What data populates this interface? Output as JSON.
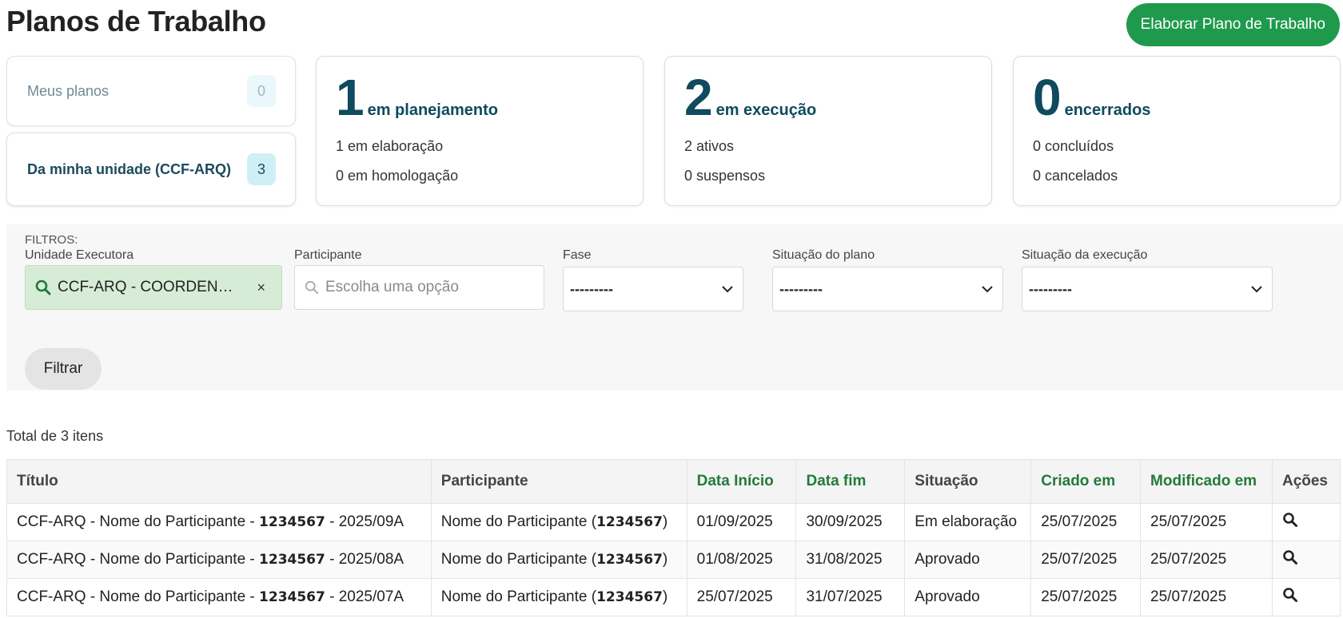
{
  "header": {
    "title": "Planos de Trabalho",
    "create_button": "Elaborar Plano de Trabalho"
  },
  "scopes": {
    "mine": {
      "label": "Meus planos",
      "count": "0"
    },
    "unit": {
      "label": "Da minha unidade (CCF-ARQ)",
      "count": "3"
    }
  },
  "stats": [
    {
      "number": "1",
      "label": "em planejamento",
      "line1": "1 em elaboração",
      "line2": "0 em homologação"
    },
    {
      "number": "2",
      "label": "em execução",
      "line1": "2 ativos",
      "line2": "0 suspensos"
    },
    {
      "number": "0",
      "label": "encerrados",
      "line1": "0 concluídos",
      "line2": "0 cancelados"
    }
  ],
  "filters": {
    "title": "FILTROS:",
    "unidade": {
      "label": "Unidade Executora",
      "value": "CCF-ARQ - COORDEN…",
      "clear": "×"
    },
    "participante": {
      "label": "Participante",
      "placeholder": "Escolha uma opção"
    },
    "fase": {
      "label": "Fase",
      "value": "---------"
    },
    "situacao_plano": {
      "label": "Situação do plano",
      "value": "---------"
    },
    "situacao_execucao": {
      "label": "Situação da execução",
      "value": "---------"
    },
    "submit": "Filtrar"
  },
  "total_label": "Total de 3 itens",
  "table": {
    "columns": [
      "Título",
      "Participante",
      "Data Início",
      "Data fim",
      "Situação",
      "Criado em",
      "Modificado em",
      "Ações"
    ],
    "rows": [
      {
        "title_prefix": "CCF-ARQ - Nome do Participante - ",
        "id": "1234567",
        "title_suffix": " - 2025/09A",
        "participant": "Nome do Participante (",
        "participant_id": "1234567",
        "participant_close": ")",
        "start": "01/09/2025",
        "end": "30/09/2025",
        "status": "Em elaboração",
        "created": "25/07/2025",
        "modified": "25/07/2025"
      },
      {
        "title_prefix": "CCF-ARQ - Nome do Participante - ",
        "id": "1234567",
        "title_suffix": " - 2025/08A",
        "participant": "Nome do Participante (",
        "participant_id": "1234567",
        "participant_close": ")",
        "start": "01/08/2025",
        "end": "31/08/2025",
        "status": "Aprovado",
        "created": "25/07/2025",
        "modified": "25/07/2025"
      },
      {
        "title_prefix": "CCF-ARQ - Nome do Participante - ",
        "id": "1234567",
        "title_suffix": " - 2025/07A",
        "participant": "Nome do Participante (",
        "participant_id": "1234567",
        "participant_close": ")",
        "start": "25/07/2025",
        "end": "31/07/2025",
        "status": "Aprovado",
        "created": "25/07/2025",
        "modified": "25/07/2025"
      }
    ]
  },
  "colors": {
    "primary": "#1f9a4d",
    "heading_teal": "#0f4a5e",
    "sort_green": "#237a3b"
  }
}
